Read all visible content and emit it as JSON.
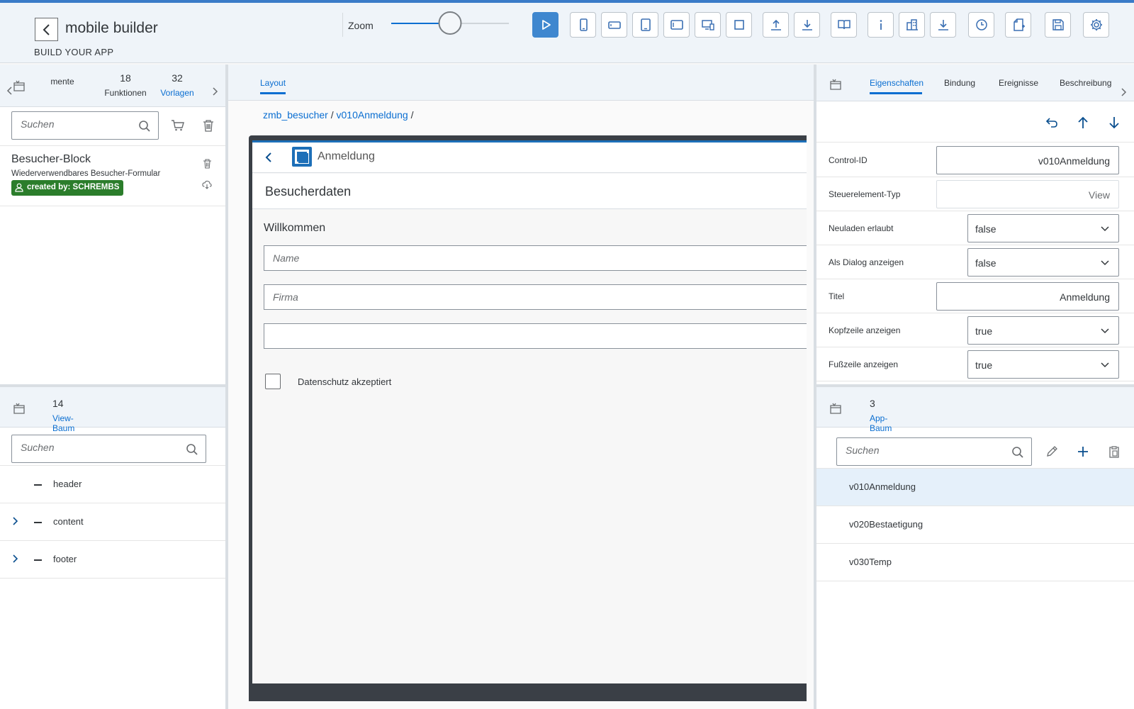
{
  "header": {
    "title": "mobile builder",
    "subtitle": "BUILD YOUR APP",
    "zoom_label": "Zoom",
    "zoom_level": 0.5,
    "toolbar_icons": [
      "play-icon",
      "phone-portrait-icon",
      "phone-landscape-icon",
      "tablet-portrait-icon",
      "tablet-landscape-icon",
      "desktop-device-icon",
      "fullscreen-icon",
      "upload-icon",
      "download-icon",
      "book-icon",
      "info-icon",
      "building-icon",
      "download-to-icon",
      "history-icon",
      "new-document-icon",
      "save-icon",
      "settings-icon"
    ]
  },
  "left_top": {
    "tabs": [
      {
        "count": "",
        "label": "mente"
      },
      {
        "count": "18",
        "label": "Funktionen"
      },
      {
        "count": "32",
        "label": "Vorlagen"
      }
    ],
    "search_placeholder": "Suchen",
    "block": {
      "title": "Besucher-Block",
      "description": "Wiederverwendbares Besucher-Formular",
      "badge": "created by: SCHREMBS"
    }
  },
  "left_bottom": {
    "tab": {
      "count": "14",
      "label": "View-Baum"
    },
    "search_placeholder": "Suchen",
    "tree": [
      "header",
      "content",
      "footer"
    ]
  },
  "center": {
    "tab": "Layout",
    "breadcrumb": [
      "zmb_besucher",
      "v010Anmeldung"
    ],
    "breadcrumb_sep": "/",
    "device": {
      "header_title": "Anmeldung",
      "section_title": "Besucherdaten",
      "panel_title": "Willkommen",
      "name_placeholder": "Name",
      "company_placeholder": "Firma",
      "checkbox_label": "Datenschutz akzeptiert"
    }
  },
  "right_top": {
    "tabs": [
      "Eigenschaften",
      "Bindung",
      "Ereignisse",
      "Beschreibung"
    ],
    "properties": [
      {
        "label": "Control-ID",
        "kind": "input",
        "value": "v010Anmeldung"
      },
      {
        "label": "Steuerelement-Typ",
        "kind": "readonly",
        "value": "View"
      },
      {
        "label": "Neuladen erlaubt",
        "kind": "select",
        "value": "false"
      },
      {
        "label": "Als Dialog anzeigen",
        "kind": "select",
        "value": "false"
      },
      {
        "label": "Titel",
        "kind": "input",
        "value": "Anmeldung"
      },
      {
        "label": "Kopfzeile anzeigen",
        "kind": "select",
        "value": "true"
      },
      {
        "label": "Fußzeile anzeigen",
        "kind": "select",
        "value": "true"
      }
    ]
  },
  "right_bottom": {
    "tab": {
      "count": "3",
      "label": "App-Baum"
    },
    "search_placeholder": "Suchen",
    "items": [
      "v010Anmeldung",
      "v020Bestaetigung",
      "v030Temp"
    ]
  },
  "colors": {
    "accent": "#0a6ed1",
    "header_bg": "#eff4f9",
    "badge_green": "#2b7d2b"
  }
}
